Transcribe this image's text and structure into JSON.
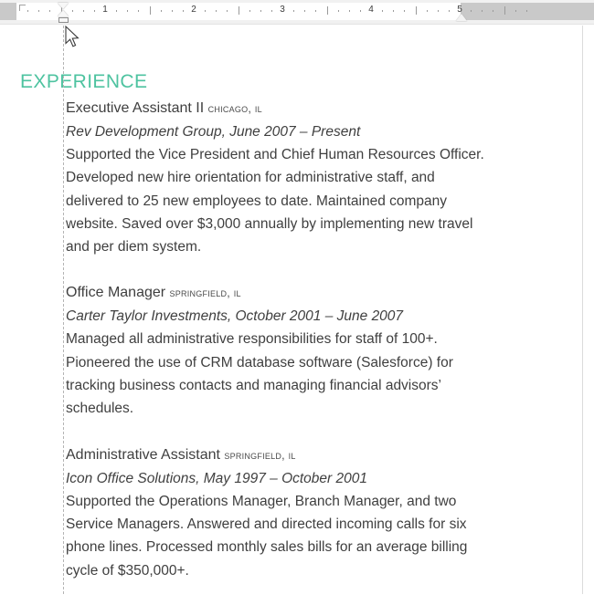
{
  "ruler": {
    "unit_labels": [
      "1",
      "2",
      "3",
      "4",
      "5"
    ],
    "markers": {
      "first_line_indent": "first-line-indent-marker",
      "hanging_indent": "hanging-indent-marker",
      "left_indent": "left-indent-marker",
      "right_indent": "right-indent-marker"
    }
  },
  "document": {
    "section_heading": "EXPERIENCE",
    "heading_color": "#4ec3a0",
    "body_color": "#3f3f3f",
    "jobs": [
      {
        "title": "Executive Assistant II",
        "location": "Chicago, IL",
        "company_and_dates": "Rev Development Group, June 2007 – Present",
        "description": "Supported the Vice President and Chief Human Resources Officer. Developed new hire orientation for administrative staff, and delivered to 25 new employees to date. Maintained company website. Saved over $3,000 annually by implementing new travel and per diem system."
      },
      {
        "title": "Office Manager",
        "location": "Springfield, IL",
        "company_and_dates": "Carter Taylor Investments, October 2001 – June 2007",
        "description": "Managed all administrative responsibilities for staff of 100+. Pioneered the use of CRM database software (Salesforce) for tracking business contacts and managing financial advisors’ schedules."
      },
      {
        "title": "Administrative Assistant",
        "location": "Springfield, IL",
        "company_and_dates": "Icon Office Solutions, May 1997 – October 2001",
        "description": "Supported the Operations Manager, Branch Manager, and two Service Managers. Answered and directed incoming calls for six phone lines. Processed monthly sales bills for an average billing cycle of $350,000+."
      }
    ]
  }
}
